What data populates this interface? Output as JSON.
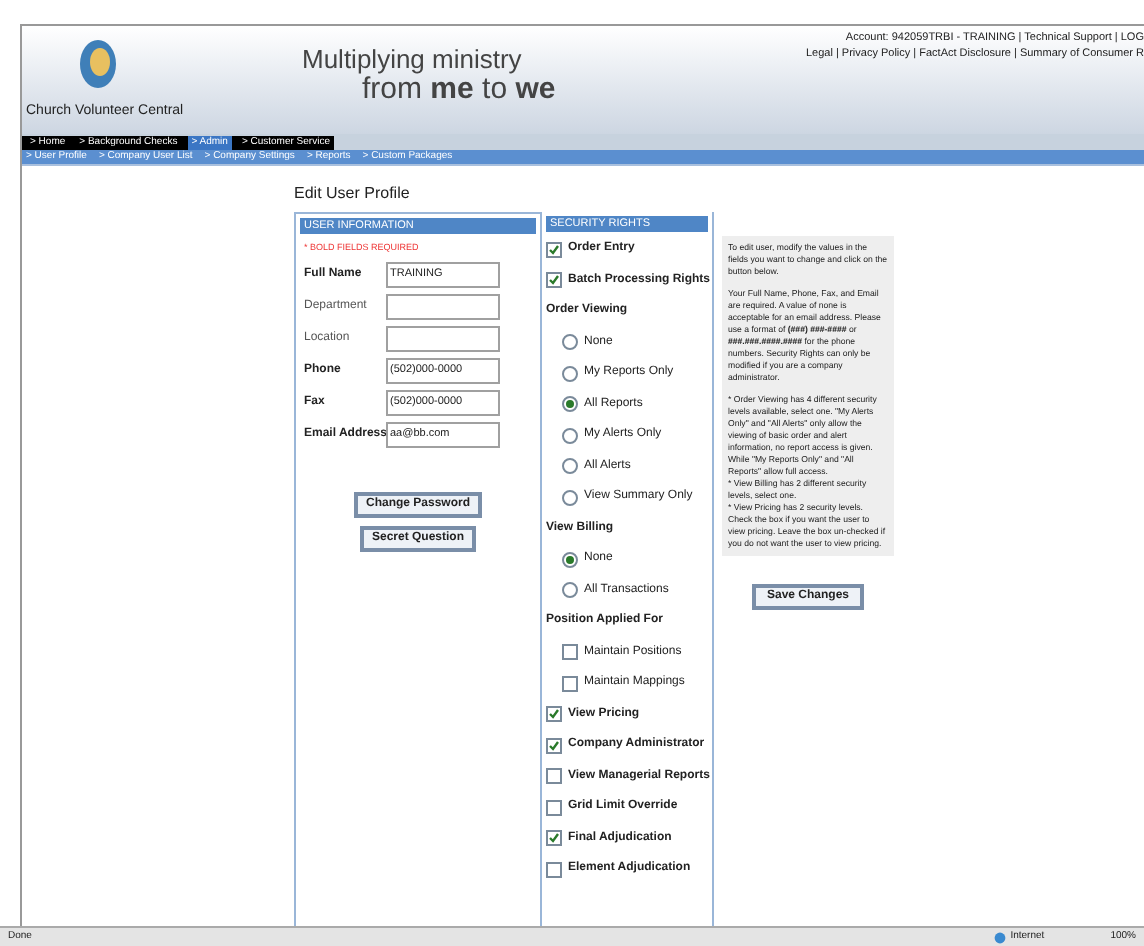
{
  "header": {
    "brand": "Church Volunteer Central",
    "tagline_top": "Multiplying ministry",
    "tagline_bottom": "from **me** to **we**",
    "account_links": "Account: 942059TRBI - TRAINING | Technical Support | LOG",
    "legal_links": "Legal | Privacy Policy | FactAct Disclosure | Summary of Consumer R"
  },
  "nav": [
    {
      "label": "> Home",
      "selected": false
    },
    {
      "label": "> Background Checks",
      "selected": false
    },
    {
      "label": "> Admin",
      "selected": true
    },
    {
      "label": "> Customer Service",
      "selected": false
    }
  ],
  "subnav": [
    "> User Profile",
    "> Company User List",
    "> Company Settings",
    "> Reports",
    "> Custom Packages"
  ],
  "title": "Edit User Profile",
  "user_info": {
    "heading": "USER INFORMATION",
    "required_note": "* BOLD FIELDS REQUIRED",
    "fields": [
      {
        "label": "Full Name",
        "required": true,
        "value": "TRAINING"
      },
      {
        "label": "Department",
        "required": false
      },
      {
        "label": "Location",
        "required": false
      },
      {
        "label": "Phone",
        "required": true,
        "value": "(502)000-0000"
      },
      {
        "label": "Fax",
        "required": true,
        "value": "(502)000-0000"
      },
      {
        "label": "Email Address",
        "required": true,
        "value": "aa@bb.com"
      }
    ],
    "buttons": [
      "Change Password",
      "Secret Question"
    ]
  },
  "security": {
    "heading": "SECURITY RIGHTS",
    "items": [
      {
        "kind": "checkbox",
        "label": "Order Entry",
        "checked": true
      },
      {
        "kind": "checkbox",
        "label": "Batch Processing Rights",
        "checked": true
      },
      {
        "kind": "heading",
        "label": "Order Viewing"
      },
      {
        "kind": "radio",
        "label": "None",
        "selected": false
      },
      {
        "kind": "radio",
        "label": "My Reports Only",
        "selected": false
      },
      {
        "kind": "radio",
        "label": "All Reports",
        "selected": true
      },
      {
        "kind": "radio",
        "label": "My Alerts Only",
        "selected": false
      },
      {
        "kind": "radio",
        "label": "All Alerts",
        "selected": false
      },
      {
        "kind": "radio",
        "label": "View Summary Only",
        "selected": false
      },
      {
        "kind": "heading",
        "label": "View Billing"
      },
      {
        "kind": "radio",
        "label": "None",
        "selected": true
      },
      {
        "kind": "radio",
        "label": "All Transactions",
        "selected": false
      },
      {
        "kind": "heading",
        "label": "Position Applied For"
      },
      {
        "kind": "subcheckbox",
        "label": "Maintain Positions",
        "checked": false
      },
      {
        "kind": "subcheckbox",
        "label": "Maintain Mappings",
        "checked": false
      },
      {
        "kind": "checkbox",
        "label": "View Pricing",
        "checked": true
      },
      {
        "kind": "checkbox",
        "label": "Company Administrator",
        "checked": true
      },
      {
        "kind": "checkbox",
        "label": "View Managerial Reports",
        "checked": false
      },
      {
        "kind": "checkbox",
        "label": "Grid Limit Override",
        "checked": false
      },
      {
        "kind": "checkbox",
        "label": "Final Adjudication",
        "checked": true
      },
      {
        "kind": "checkbox",
        "label": "Element Adjudication",
        "checked": false
      }
    ]
  },
  "help": [
    "To edit user, modify the values in the fields you want to change and click on the button below.",
    "Your Full Name, Phone, Fax, and Email are required. A value of none is acceptable for an email address. Please use a format of **(###) ###-####** or **###.###.####.####** for the phone numbers. Security Rights can only be modified if you are a company administrator.",
    "* Order Viewing has 4 different security levels available, select one. \"My Alerts Only\" and \"All Alerts\" only allow the viewing of basic order and alert information, no report access is given. While \"My Reports Only\" and \"All Reports\" allow full access.\n* View Billing has 2 different security levels, select one.\n* View Pricing has 2 security levels. Check the box if you want the user to view pricing. Leave the box un-checked if you do not want the user to view pricing."
  ],
  "save_button": "Save Changes",
  "status_bar": {
    "left": "Done",
    "zone": "Internet",
    "zoom": "100%"
  }
}
